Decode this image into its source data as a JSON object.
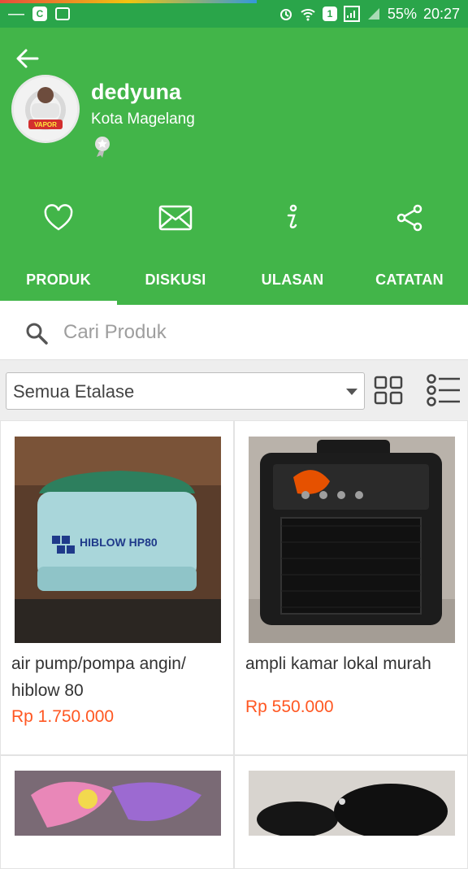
{
  "statusbar": {
    "battery": "55%",
    "time": "20:27",
    "sim": "1"
  },
  "profile": {
    "name": "dedyuna",
    "city": "Kota Magelang",
    "avatar_caption": "VAPOR"
  },
  "tabs": [
    {
      "label": "PRODUK",
      "active": true
    },
    {
      "label": "DISKUSI",
      "active": false
    },
    {
      "label": "ULASAN",
      "active": false
    },
    {
      "label": "CATATAN",
      "active": false
    }
  ],
  "search": {
    "placeholder": "Cari Produk"
  },
  "filter": {
    "selected": "Semua Etalase"
  },
  "products": [
    {
      "title": "air pump/pompa angin/ hiblow 80",
      "price": "Rp 1.750.000",
      "image_label": "HIBLOW HP80"
    },
    {
      "title": "ampli kamar lokal murah",
      "price": "Rp 550.000"
    },
    {
      "title": "",
      "price": ""
    },
    {
      "title": "",
      "price": ""
    }
  ],
  "colors": {
    "brand_green": "#42b549",
    "status_green": "#2aa54a",
    "price_orange": "#ff5722"
  }
}
